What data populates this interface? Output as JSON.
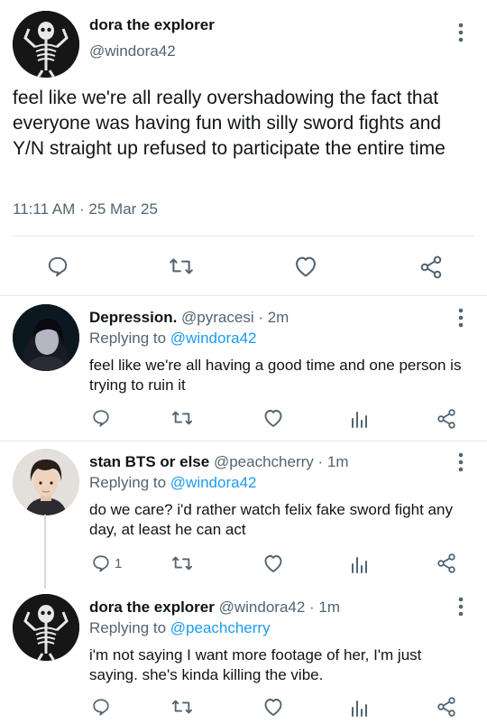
{
  "main_tweet": {
    "name": "dora the explorer",
    "handle": "@windora42",
    "text": "feel like we're all really overshadowing the fact that everyone was having fun with silly sword fights and Y/N straight up refused to participate the entire time",
    "timestamp": "11:11 AM · 25 Mar 25",
    "actions": [
      "comment-icon",
      "retweet-icon",
      "like-icon",
      "share-icon"
    ]
  },
  "replies": [
    {
      "name": "Depression.",
      "handle": "@pyracesi",
      "time": "· 2m",
      "replying_prefix": "Replying to ",
      "replying_to": "@windora42",
      "text": "feel like we're all having a good time and one person is trying to ruin it",
      "reply_count": ""
    },
    {
      "name": "stan BTS or else",
      "handle": "@peachcherry",
      "time": "· 1m",
      "replying_prefix": "Replying to ",
      "replying_to": "@windora42",
      "text": "do we care? i'd rather watch felix fake sword fight any day, at least he can act",
      "reply_count": "1"
    },
    {
      "name": "dora the explorer",
      "handle": "@windora42",
      "time": "· 1m",
      "replying_prefix": "Replying to ",
      "replying_to": "@peachcherry",
      "text": "i'm not saying I want more footage of her, I'm just saying. she's kinda killing the vibe.",
      "reply_count": ""
    }
  ],
  "colors": {
    "link": "#1d9bf0",
    "muted": "#536471",
    "text": "#0f1419"
  }
}
